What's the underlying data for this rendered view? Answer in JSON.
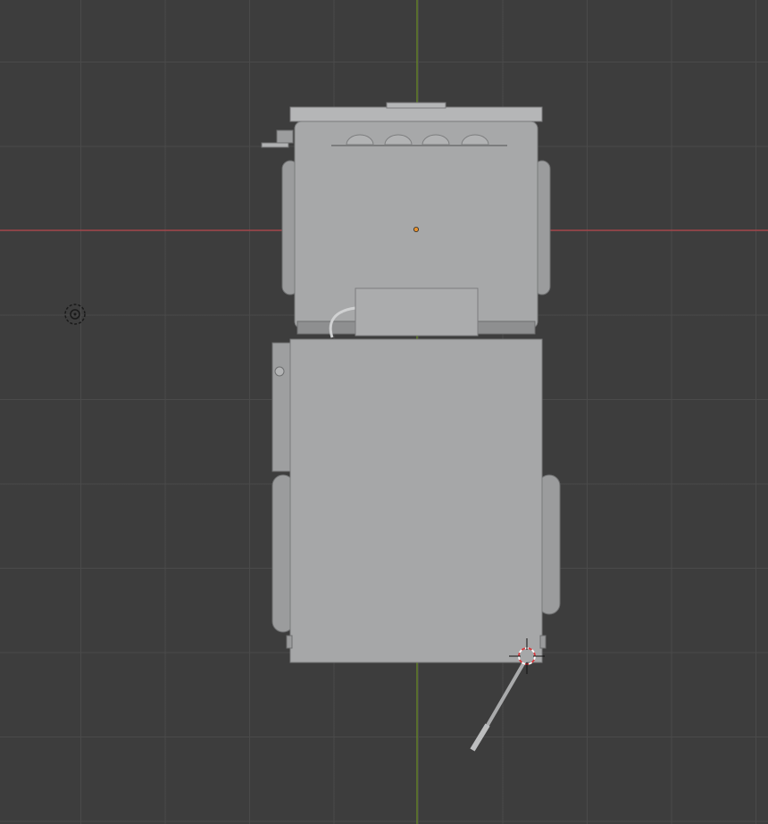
{
  "viewport": {
    "background_color": "#3d3d3d",
    "grid_color": "#4b4b4b",
    "x_axis_color": "#b5444a",
    "y_axis_color": "#6b8e23"
  },
  "scene": {
    "object_color": "#a6a7a8",
    "object_highlight": "#b8b9ba",
    "object_shadow": "#7e7f80",
    "origin_color": "#e8922e",
    "cursor_color": "#d9383d"
  },
  "icons": {
    "light": "light-icon",
    "cursor": "3d-cursor-icon",
    "origin": "object-origin-icon"
  }
}
